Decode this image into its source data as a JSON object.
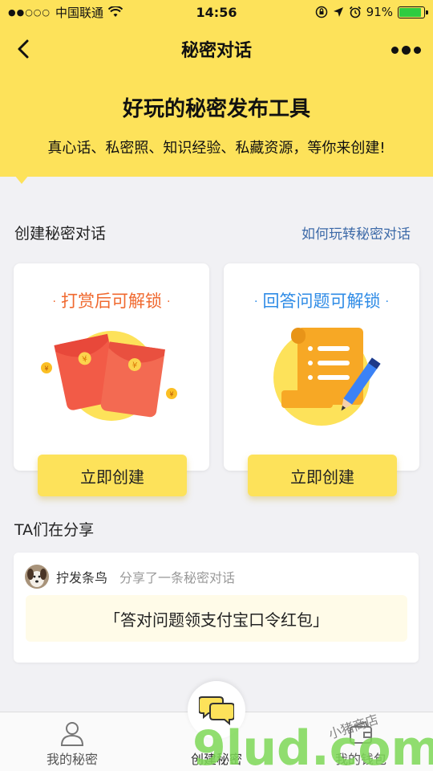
{
  "status_bar": {
    "carrier": "中国联通",
    "time": "14:56",
    "battery_percent": "91%",
    "battery_level": 0.91
  },
  "nav": {
    "title": "秘密对话"
  },
  "banner": {
    "title": "好玩的秘密发布工具",
    "subtitle": "真心话、私密照、知识经验、私藏资源，等你来创建!"
  },
  "create_section": {
    "title": "创建秘密对话",
    "link": "如何玩转秘密对话"
  },
  "cards": [
    {
      "title": "打赏后可解锁",
      "button": "立即创建",
      "icon": "red-envelope-icon"
    },
    {
      "title": "回答问题可解锁",
      "button": "立即创建",
      "icon": "scroll-pencil-icon"
    }
  ],
  "share_section": {
    "title": "TA们在分享",
    "items": [
      {
        "user": "拧发条鸟",
        "action": "分享了一条秘密对话",
        "quote": "「答对问题领支付宝口令红包」"
      }
    ]
  },
  "tabbar": {
    "tabs": [
      {
        "label": "我的秘密",
        "icon": "person-icon"
      },
      {
        "label": "创建秘密",
        "icon": "chat-bubbles-icon"
      },
      {
        "label": "我的钱包",
        "icon": "wallet-icon"
      }
    ]
  },
  "watermark": {
    "text": "9lud.com",
    "handwriting": "小猪商店"
  },
  "colors": {
    "accent_yellow": "#fde25a",
    "orange": "#f0692f",
    "blue": "#2e8be6",
    "link": "#3d6aa8"
  }
}
